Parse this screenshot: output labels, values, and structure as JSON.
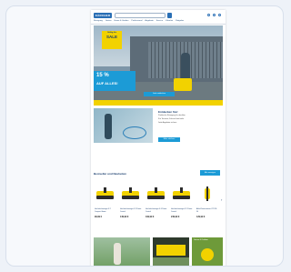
{
  "header": {
    "logo_text": "KÄRCHER",
    "nav_items": [
      "Reinigung",
      "Garten",
      "Home & Garden",
      "Professional",
      "Angebote",
      "Service",
      "Zubehör",
      "Ratgeber"
    ]
  },
  "hero": {
    "badge_line1": "Gültig bis",
    "badge_line2": "SALE",
    "offer_line1": "15 %",
    "offer_line2": "AUF ALLES!",
    "cta_label": "Jetzt entdecken"
  },
  "promo": {
    "title": "Entdecken Sie!",
    "lines": [
      "Praktische Reinigung für draußen",
      "Für Terrasse, Fahrrad und mehr",
      "Jetzt Angebote sichern"
    ],
    "button_label": "Mehr erfahren"
  },
  "products_section": {
    "title": "Bestseller und Neuheiten",
    "button_label": "Alle anzeigen",
    "items": [
      {
        "name": "Hochdruckreiniger K 2 Compact Home",
        "price": "99,99 €"
      },
      {
        "name": "Hochdruckreiniger K 3 Power Control",
        "price": "149,99 €"
      },
      {
        "name": "Hochdruckreiniger K 4 Power Control",
        "price": "199,99 €"
      },
      {
        "name": "Hochdruckreiniger K 5 Power Control",
        "price": "249,99 €"
      },
      {
        "name": "Akku-Rasentrimmer LTR 18-30",
        "price": "129,99 €"
      }
    ]
  },
  "bottom": {
    "tile3_text": "Garten & Outdoor"
  },
  "colors": {
    "brand_blue": "#2a6fb5",
    "accent_yellow": "#f2d200",
    "cta_blue": "#1c9bd6"
  }
}
